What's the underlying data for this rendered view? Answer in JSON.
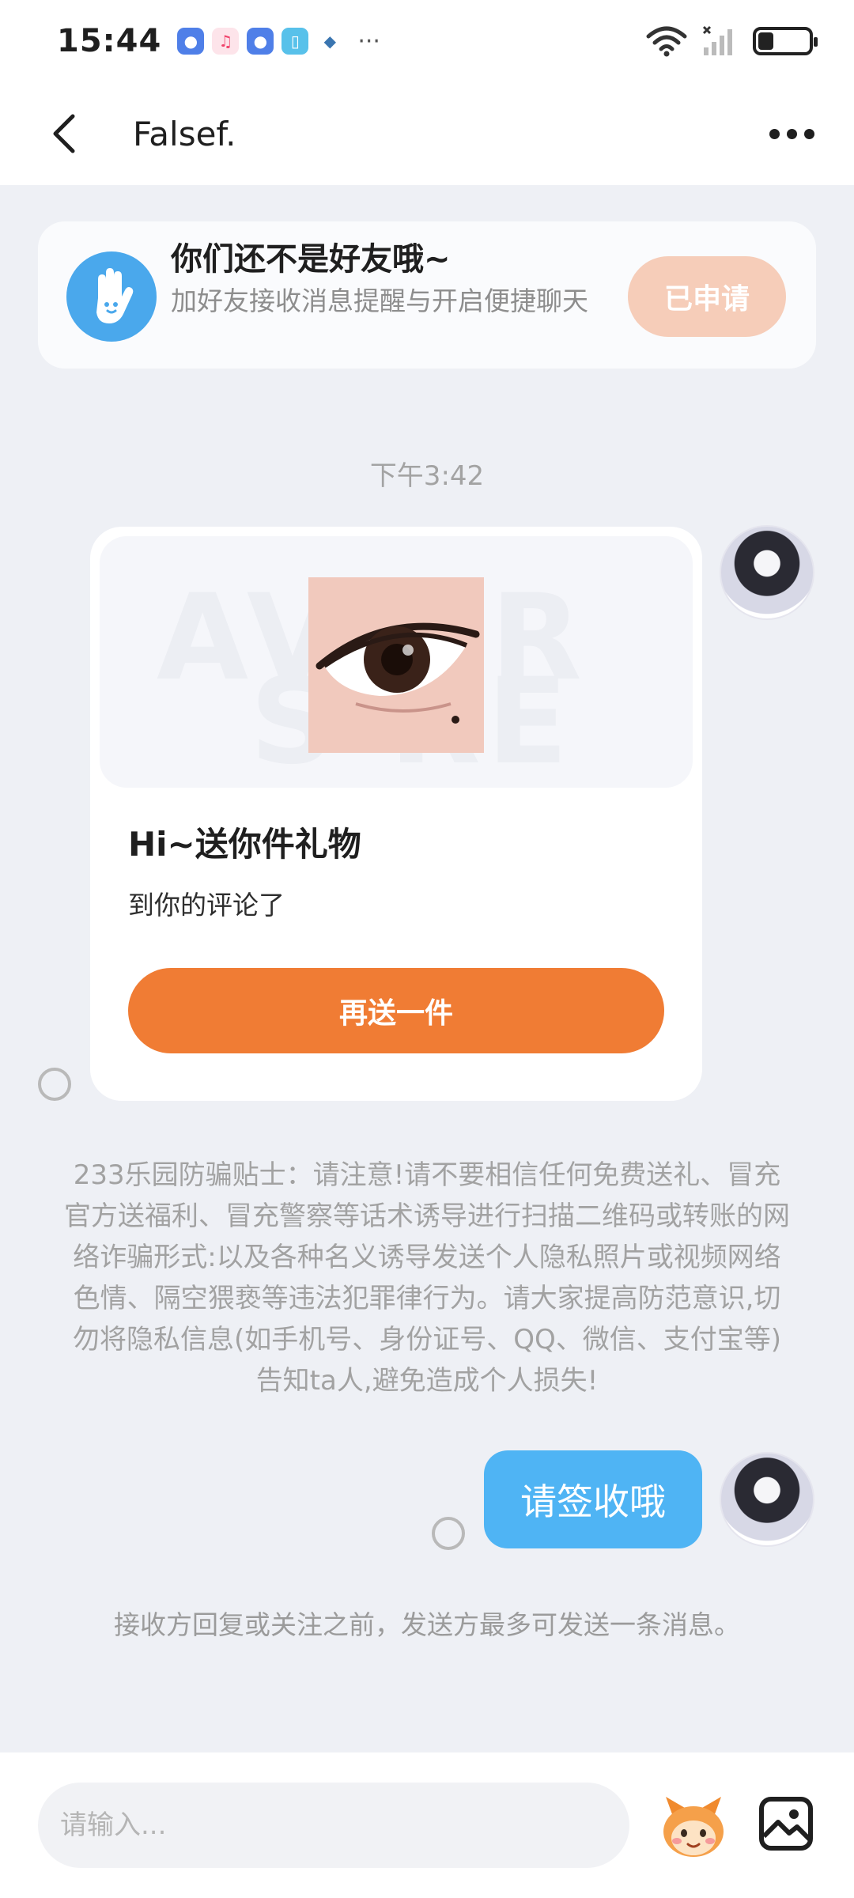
{
  "status_bar": {
    "time": "15:44",
    "more": "···",
    "battery_level": 0.3
  },
  "header": {
    "title": "Falsef."
  },
  "friend_banner": {
    "title": "你们还不是好友哦~",
    "subtitle": "加好友接收消息提醒与开启便捷聊天",
    "button": "已申请"
  },
  "chat": {
    "timestamp": "下午3:42",
    "gift_card": {
      "title": "Hi~送你件礼物",
      "description": "到你的评论了",
      "button": "再送一件"
    },
    "fraud_tip": "233乐园防骗贴士：请注意!请不要相信任何免费送礼、冒充官方送福利、冒充警察等话术诱导进行扫描二维码或转账的网络诈骗形式:以及各种名义诱导发送个人隐私照片或视频网络色情、隔空猥亵等违法犯罪律行为。请大家提高防范意识,切勿将隐私信息(如手机号、身份证号、QQ、微信、支付宝等)告知ta人,避免造成个人损失!",
    "my_message": "请签收哦",
    "send_limit_notice": "接收方回复或关注之前，发送方最多可发送一条消息。"
  },
  "input_bar": {
    "placeholder": "请输入..."
  },
  "colors": {
    "accent_orange": "#f07c34",
    "bubble_blue": "#4fb4f4",
    "applied_button": "#f6cdb9"
  }
}
